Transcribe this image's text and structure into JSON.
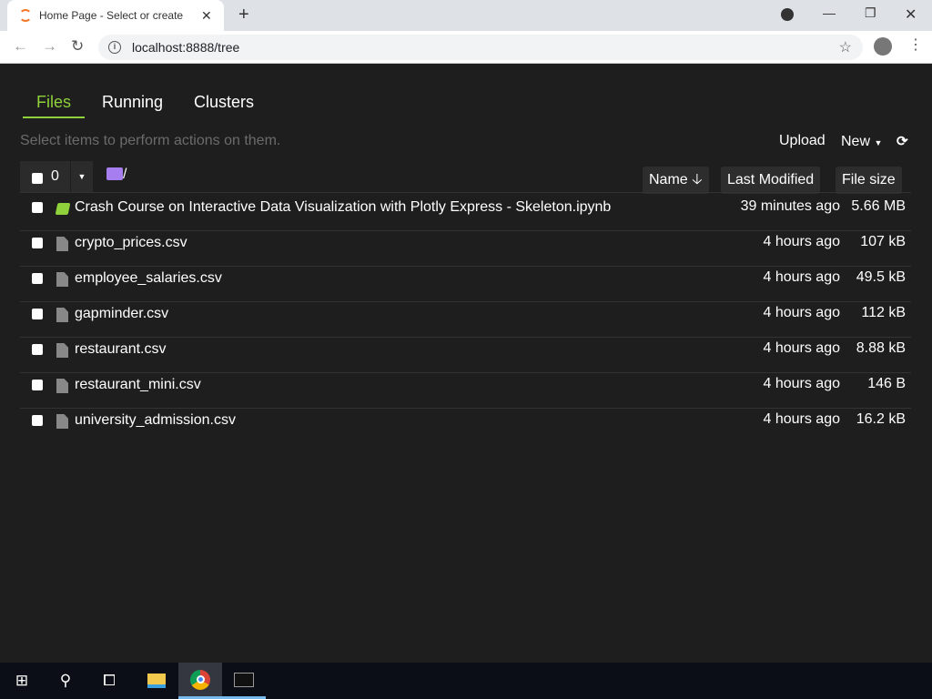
{
  "browser": {
    "tab_title": "Home Page - Select or create a notebook",
    "url": "localhost:8888/tree"
  },
  "tabs": [
    "Files",
    "Running",
    "Clusters"
  ],
  "hint": "Select items to perform actions on them.",
  "actions": {
    "upload": "Upload",
    "new": "New"
  },
  "selected_count": "0",
  "breadcrumb": "/",
  "columns": {
    "name": "Name",
    "modified": "Last Modified",
    "size": "File size"
  },
  "files": [
    {
      "name": "Crash Course on Interactive Data Visualization with Plotly Express - Skeleton.ipynb",
      "modified": "39 minutes ago",
      "size": "5.66 MB",
      "type": "notebook"
    },
    {
      "name": "crypto_prices.csv",
      "modified": "4 hours ago",
      "size": "107 kB",
      "type": "file"
    },
    {
      "name": "employee_salaries.csv",
      "modified": "4 hours ago",
      "size": "49.5 kB",
      "type": "file"
    },
    {
      "name": "gapminder.csv",
      "modified": "4 hours ago",
      "size": "112 kB",
      "type": "file"
    },
    {
      "name": "restaurant.csv",
      "modified": "4 hours ago",
      "size": "8.88 kB",
      "type": "file"
    },
    {
      "name": "restaurant_mini.csv",
      "modified": "4 hours ago",
      "size": "146 B",
      "type": "file"
    },
    {
      "name": "university_admission.csv",
      "modified": "4 hours ago",
      "size": "16.2 kB",
      "type": "file"
    }
  ]
}
